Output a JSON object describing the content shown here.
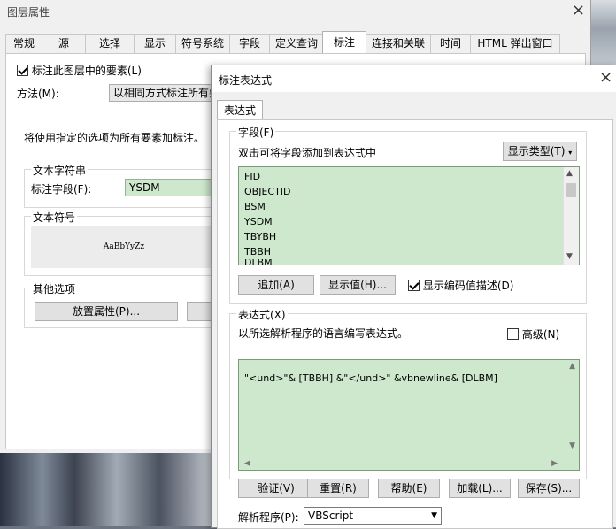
{
  "main_window": {
    "title": "图层属性",
    "close_glyph": "×",
    "tabs": [
      "常规",
      "源",
      "选择",
      "显示",
      "符号系统",
      "字段",
      "定义查询",
      "标注",
      "连接和关联",
      "时间",
      "HTML 弹出窗口"
    ],
    "active_tab": "标注",
    "label_checkbox": "标注此图层中的要素(L)",
    "method_label": "方法(M):",
    "method_value": "以相同方式标注所有要",
    "info_text": "将使用指定的选项为所有要素加标注。",
    "text_string_group": "文本字符串",
    "label_field_label": "标注字段(F):",
    "label_field_value": "YSDM",
    "text_symbol_group": "文本符号",
    "symbol_preview": "AaBbYyZz",
    "other_options_group": "其他选项",
    "placement_button": "放置属性(P)..."
  },
  "dialog": {
    "title": "标注表达式",
    "close_glyph": "×",
    "tab": "表达式",
    "fields_section": "字段(F)",
    "fields_hint": "双击可将字段添加到表达式中",
    "show_type_button": "显示类型(T)",
    "fields": [
      "FID",
      "OBJECTID",
      "BSM",
      "YSDM",
      "TBYBH",
      "TBBH",
      "DLBM"
    ],
    "append_button": "追加(A)",
    "show_values_button": "显示值(H)...",
    "show_coded_checkbox": "显示编码值描述(D)",
    "expression_section": "表达式(X)",
    "expression_hint": "以所选解析程序的语言编写表达式。",
    "advanced_checkbox": "高级(N)",
    "expression": "\"<und>\"& [TBBH] &\"</und>\" &vbnewline& [DLBM]",
    "verify_button": "验证(V)",
    "reset_button": "重置(R)",
    "help_button": "帮助(E)",
    "load_button": "加载(L)...",
    "save_button": "保存(S)...",
    "parser_label": "解析程序(P):",
    "parser_value": "VBScript"
  },
  "watermark": "CSDN @yngsqq",
  "colors": {
    "field_green": "#cde8cc",
    "window_bg": "#f0f0f0",
    "panel_bg": "#ffffff"
  }
}
